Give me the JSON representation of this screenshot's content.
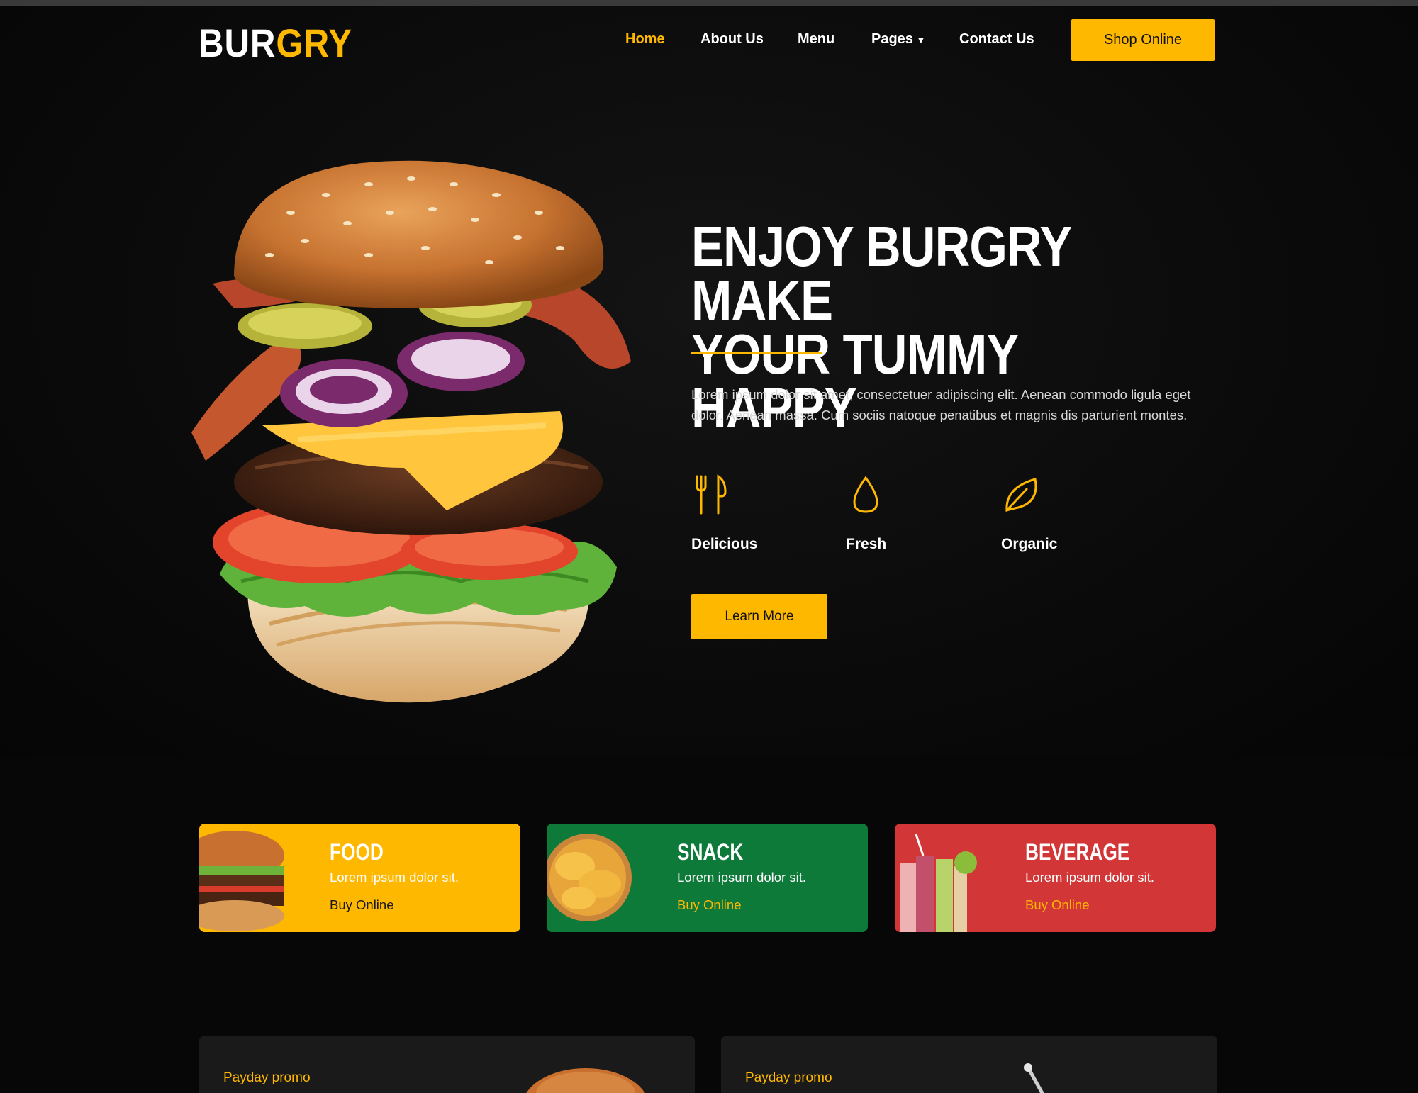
{
  "brand": {
    "part1": "BUR",
    "part2": "GRY"
  },
  "nav": {
    "items": [
      {
        "label": "Home",
        "active": true
      },
      {
        "label": "About Us",
        "active": false
      },
      {
        "label": "Menu",
        "active": false
      },
      {
        "label": "Pages",
        "active": false,
        "dropdown": true
      },
      {
        "label": "Contact Us",
        "active": false
      }
    ],
    "cta": "Shop Online"
  },
  "hero": {
    "title_line1": "ENJOY BURGRY MAKE",
    "title_line2": "YOUR TUMMY HAPPY",
    "description": "Lorem ipsum dolor sit amet, consectetuer adipiscing elit. Aenean commodo ligula eget dolor. Aenean massa. Cum sociis natoque penatibus et magnis dis parturient montes.",
    "features": [
      {
        "label": "Delicious",
        "icon": "fork-knife-icon"
      },
      {
        "label": "Fresh",
        "icon": "droplet-icon"
      },
      {
        "label": "Organic",
        "icon": "leaf-icon"
      }
    ],
    "button": "Learn More"
  },
  "categories": [
    {
      "title": "FOOD",
      "subtitle": "Lorem ipsum dolor sit.",
      "link": "Buy Online",
      "bg": "#ffb800",
      "link_color": "#1a1a1a"
    },
    {
      "title": "SNACK",
      "subtitle": "Lorem ipsum dolor sit.",
      "link": "Buy Online",
      "bg": "#0e7a3a",
      "link_color": "#ffb800"
    },
    {
      "title": "BEVERAGE",
      "subtitle": "Lorem ipsum dolor sit.",
      "link": "Buy Online",
      "bg": "#d33636",
      "link_color": "#ffb800"
    }
  ],
  "promos": [
    {
      "label": "Payday promo"
    },
    {
      "label": "Payday promo"
    }
  ],
  "colors": {
    "accent": "#ffb800",
    "background": "#070707"
  }
}
